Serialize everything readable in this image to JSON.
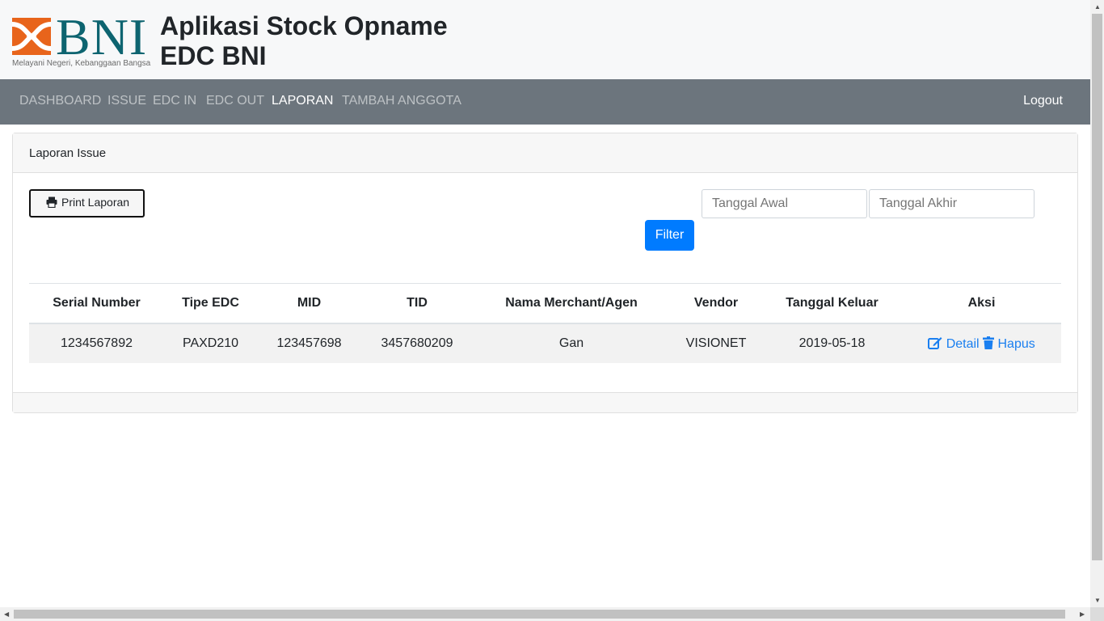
{
  "brand": {
    "logo_text": "BNI",
    "tagline": "Melayani Negeri, Kebanggaan Bangsa",
    "title_line1": "Aplikasi Stock Opname",
    "title_line2": "EDC BNI",
    "logo_color": "#0d6470",
    "mark_color": "#e8641b"
  },
  "nav": {
    "items": [
      "DASHBOARD",
      "ISSUE",
      "EDC IN",
      "EDC OUT",
      "LAPORAN",
      "TAMBAH ANGGOTA"
    ],
    "active": "LAPORAN",
    "logout": "Logout"
  },
  "card": {
    "title": "Laporan Issue",
    "print_button": "Print Laporan",
    "start_date_placeholder": "Tanggal Awal",
    "end_date_placeholder": "Tanggal Akhir",
    "filter_button": "Filter"
  },
  "table": {
    "columns": [
      "Serial Number",
      "Tipe EDC",
      "MID",
      "TID",
      "Nama Merchant/Agen",
      "Vendor",
      "Tanggal Keluar",
      "Aksi"
    ],
    "rows": [
      {
        "serial": "1234567892",
        "tipe": "PAXD210",
        "mid": "123457698",
        "tid": "3457680209",
        "merchant": "Gan",
        "vendor": "VISIONET",
        "tanggal": "2019-05-18",
        "detail": "Detail",
        "hapus": "Hapus"
      }
    ]
  },
  "colors": {
    "navbar": "#6c757d",
    "primary": "#007bff",
    "link": "#1a7ff0"
  }
}
